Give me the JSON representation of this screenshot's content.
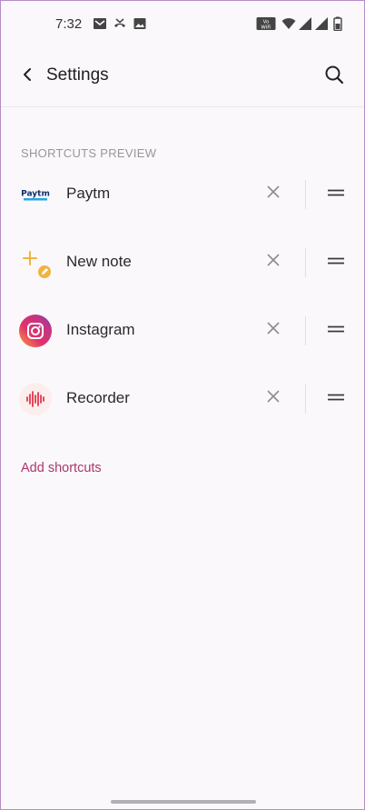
{
  "status_bar": {
    "time": "7:32",
    "icons_left": [
      "gmail-icon",
      "missed-call-icon",
      "image-icon"
    ],
    "icons_right": [
      "volte-wifi-icon",
      "wifi-icon",
      "signal-icon",
      "signal-icon-2",
      "battery-icon"
    ]
  },
  "header": {
    "title": "Settings",
    "back_icon": "arrow-left-icon",
    "search_icon": "search-icon"
  },
  "section": {
    "label": "SHORTCUTS PREVIEW"
  },
  "shortcuts": [
    {
      "label": "Paytm",
      "icon": "paytm-icon"
    },
    {
      "label": "New note",
      "icon": "new-note-icon"
    },
    {
      "label": "Instagram",
      "icon": "instagram-icon"
    },
    {
      "label": "Recorder",
      "icon": "recorder-icon"
    }
  ],
  "add_shortcuts_label": "Add shortcuts",
  "colors": {
    "accent": "#a8386d",
    "background": "#fbf8fb",
    "secondary_text": "#9a959b"
  }
}
